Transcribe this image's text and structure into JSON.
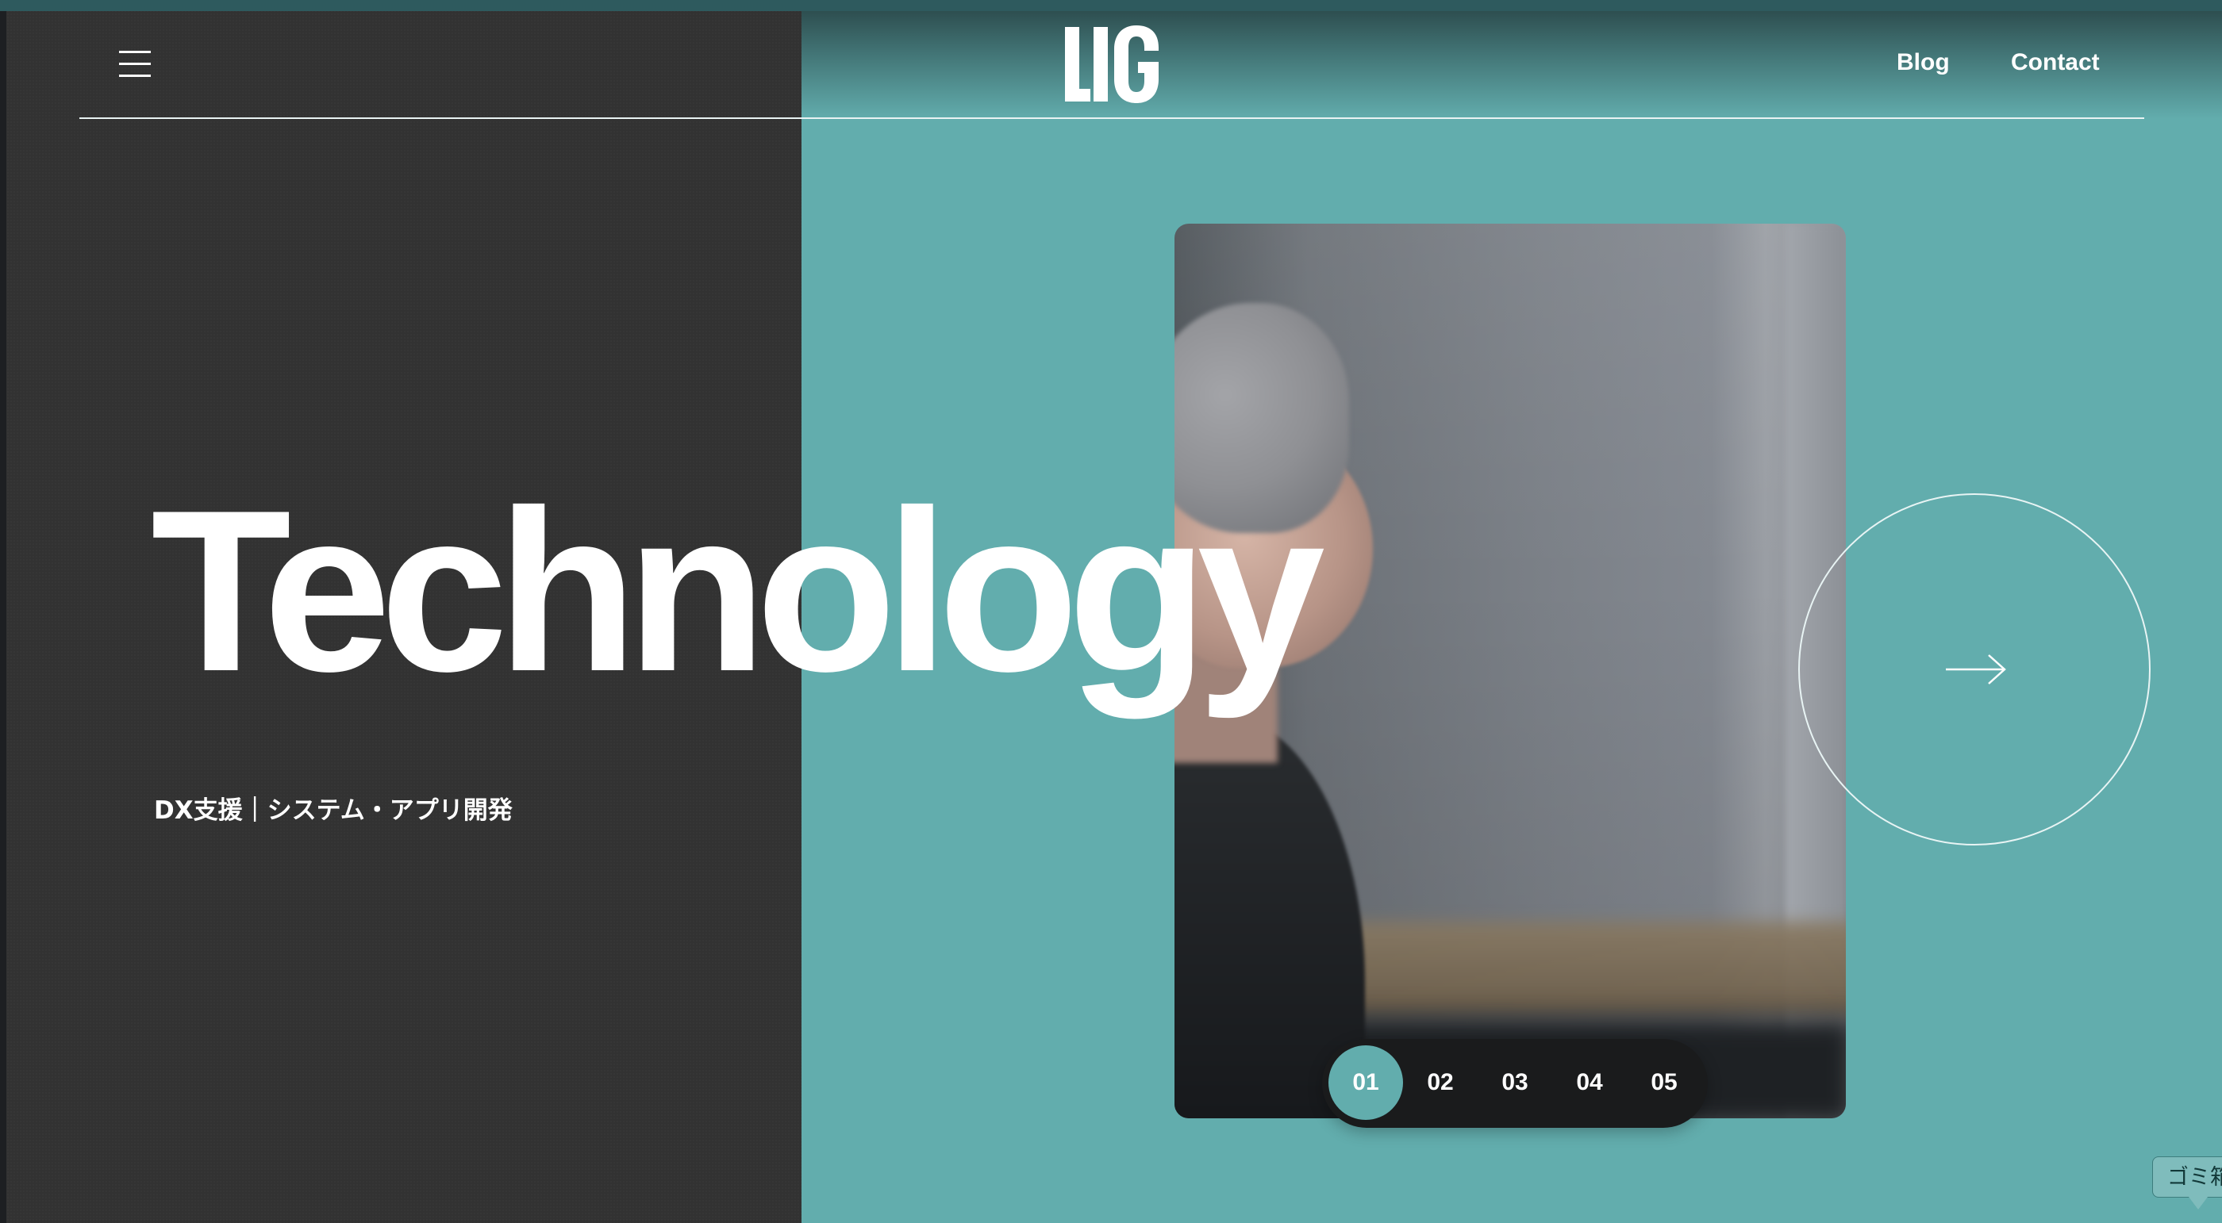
{
  "header": {
    "logo_text": "LIG",
    "nav": [
      {
        "label": "Blog"
      },
      {
        "label": "Contact"
      }
    ]
  },
  "hero": {
    "title": "Technology",
    "subtitle": "DX支援｜システム・アプリ開発"
  },
  "pager": {
    "items": [
      "01",
      "02",
      "03",
      "04",
      "05"
    ],
    "active_index": 0
  },
  "tooltip": {
    "text": "ゴミ箱"
  },
  "colors": {
    "accent": "#62adad",
    "dark_panel": "#323232",
    "pager_bg": "#1a1b1c",
    "text": "#ffffff"
  },
  "icons": {
    "menu": "hamburger-menu-icon",
    "next": "arrow-right-icon"
  }
}
